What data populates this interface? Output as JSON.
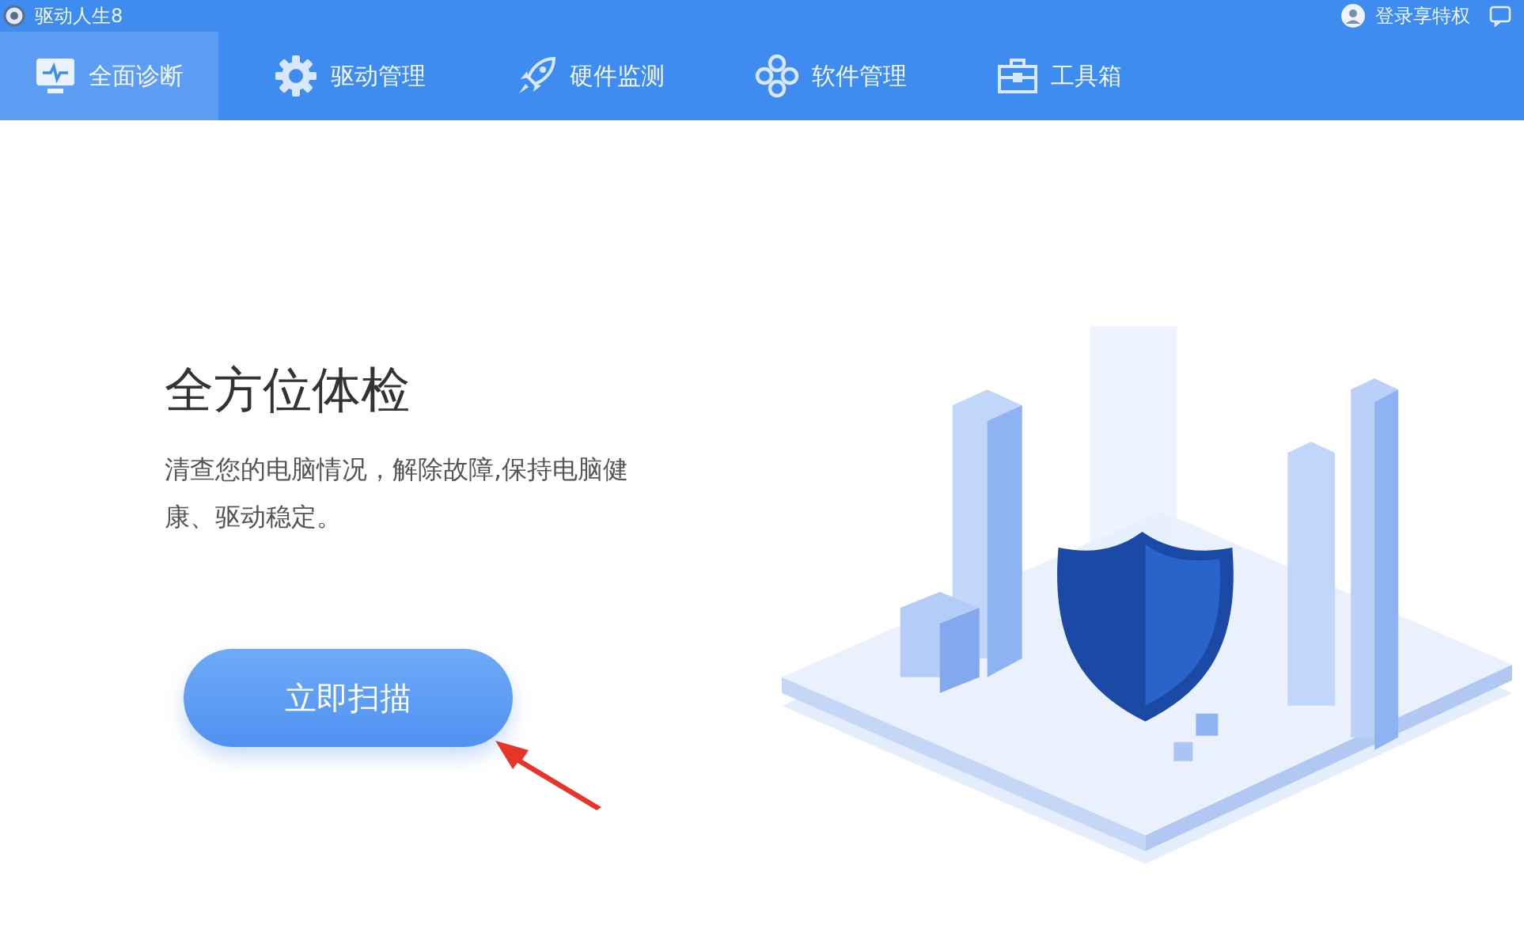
{
  "app_title": "驱动人生8",
  "login": "登录享特权",
  "tabs": [
    {
      "label": "全面诊断",
      "selected": true
    },
    {
      "label": "驱动管理",
      "selected": false
    },
    {
      "label": "硬件监测",
      "selected": false
    },
    {
      "label": "软件管理",
      "selected": false
    },
    {
      "label": "工具箱",
      "selected": false
    }
  ],
  "heading": "全方位体检",
  "description": "清查您的电脑情况，解除故障,保持电脑健康、驱动稳定。",
  "scan_button": "立即扫描"
}
